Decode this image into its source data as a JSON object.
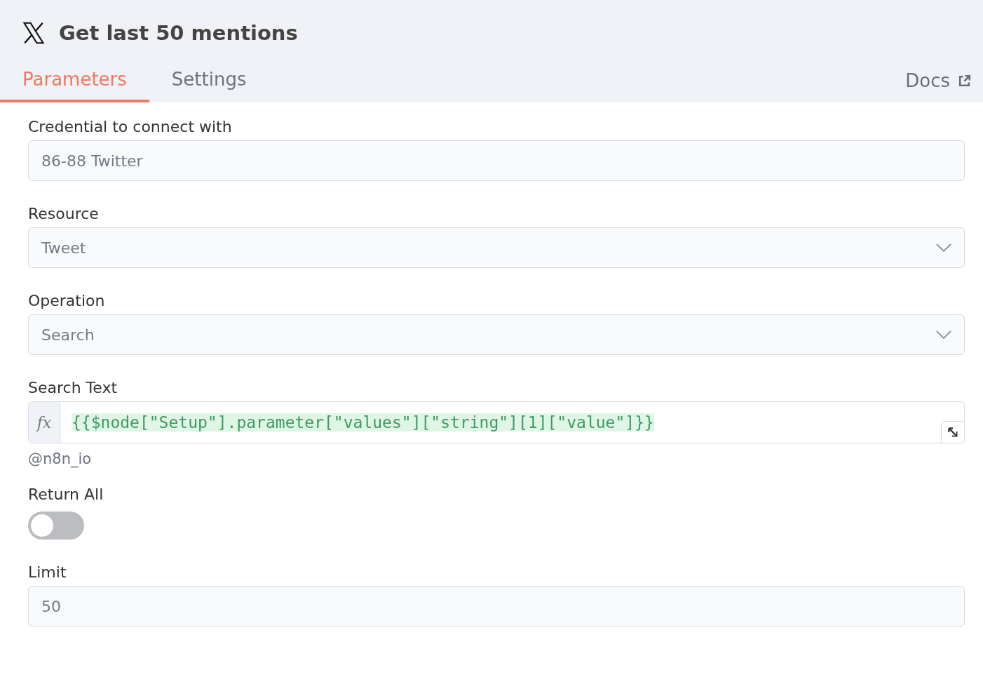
{
  "header": {
    "title": "Get last 50 mentions"
  },
  "tabs": [
    {
      "label": "Parameters",
      "selected": true
    },
    {
      "label": "Settings",
      "selected": false
    }
  ],
  "docs_link": {
    "label": "Docs"
  },
  "fields": [
    {
      "kind": "text",
      "label": "Credential to connect with",
      "value": "86-88 Twitter"
    },
    {
      "kind": "select",
      "label": "Resource",
      "value": "Tweet"
    },
    {
      "kind": "select",
      "label": "Operation",
      "value": "Search"
    },
    {
      "kind": "expression",
      "label": "Search Text",
      "prefix": "fx",
      "value": "{{$node[\"Setup\"].parameter[\"values\"][\"string\"][1][\"value\"]}}",
      "hint": "@n8n_io"
    },
    {
      "kind": "toggle",
      "label": "Return All",
      "on": false
    },
    {
      "kind": "number",
      "label": "Limit",
      "value": "50"
    }
  ]
}
